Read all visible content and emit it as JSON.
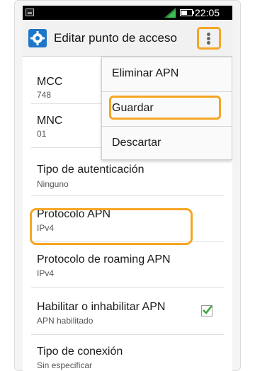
{
  "status_bar": {
    "time": "22:05"
  },
  "action_bar": {
    "title": "Editar punto de acceso",
    "icon": "settings-gear-icon",
    "overflow_icon": "more-vert-icon"
  },
  "menu": {
    "items": [
      {
        "label": "Eliminar APN"
      },
      {
        "label": "Guardar"
      },
      {
        "label": "Descartar"
      }
    ]
  },
  "preferences": [
    {
      "title": "MCC",
      "summary": "748"
    },
    {
      "title": "MNC",
      "summary": "01"
    },
    {
      "title": "Tipo de autenticación",
      "summary": "Ninguno"
    },
    {
      "title": "Protocolo APN",
      "summary": "IPv4"
    },
    {
      "title": "Protocolo de roaming APN",
      "summary": "IPv4"
    },
    {
      "title": "Habilitar o inhabilitar APN",
      "summary": "APN habilitado",
      "checked": true
    },
    {
      "title": "Tipo de conexión",
      "summary": "Sin especificar"
    }
  ],
  "colors": {
    "highlight": "#f5a623",
    "accent": "#1e76c9",
    "check": "#3aa63a"
  }
}
